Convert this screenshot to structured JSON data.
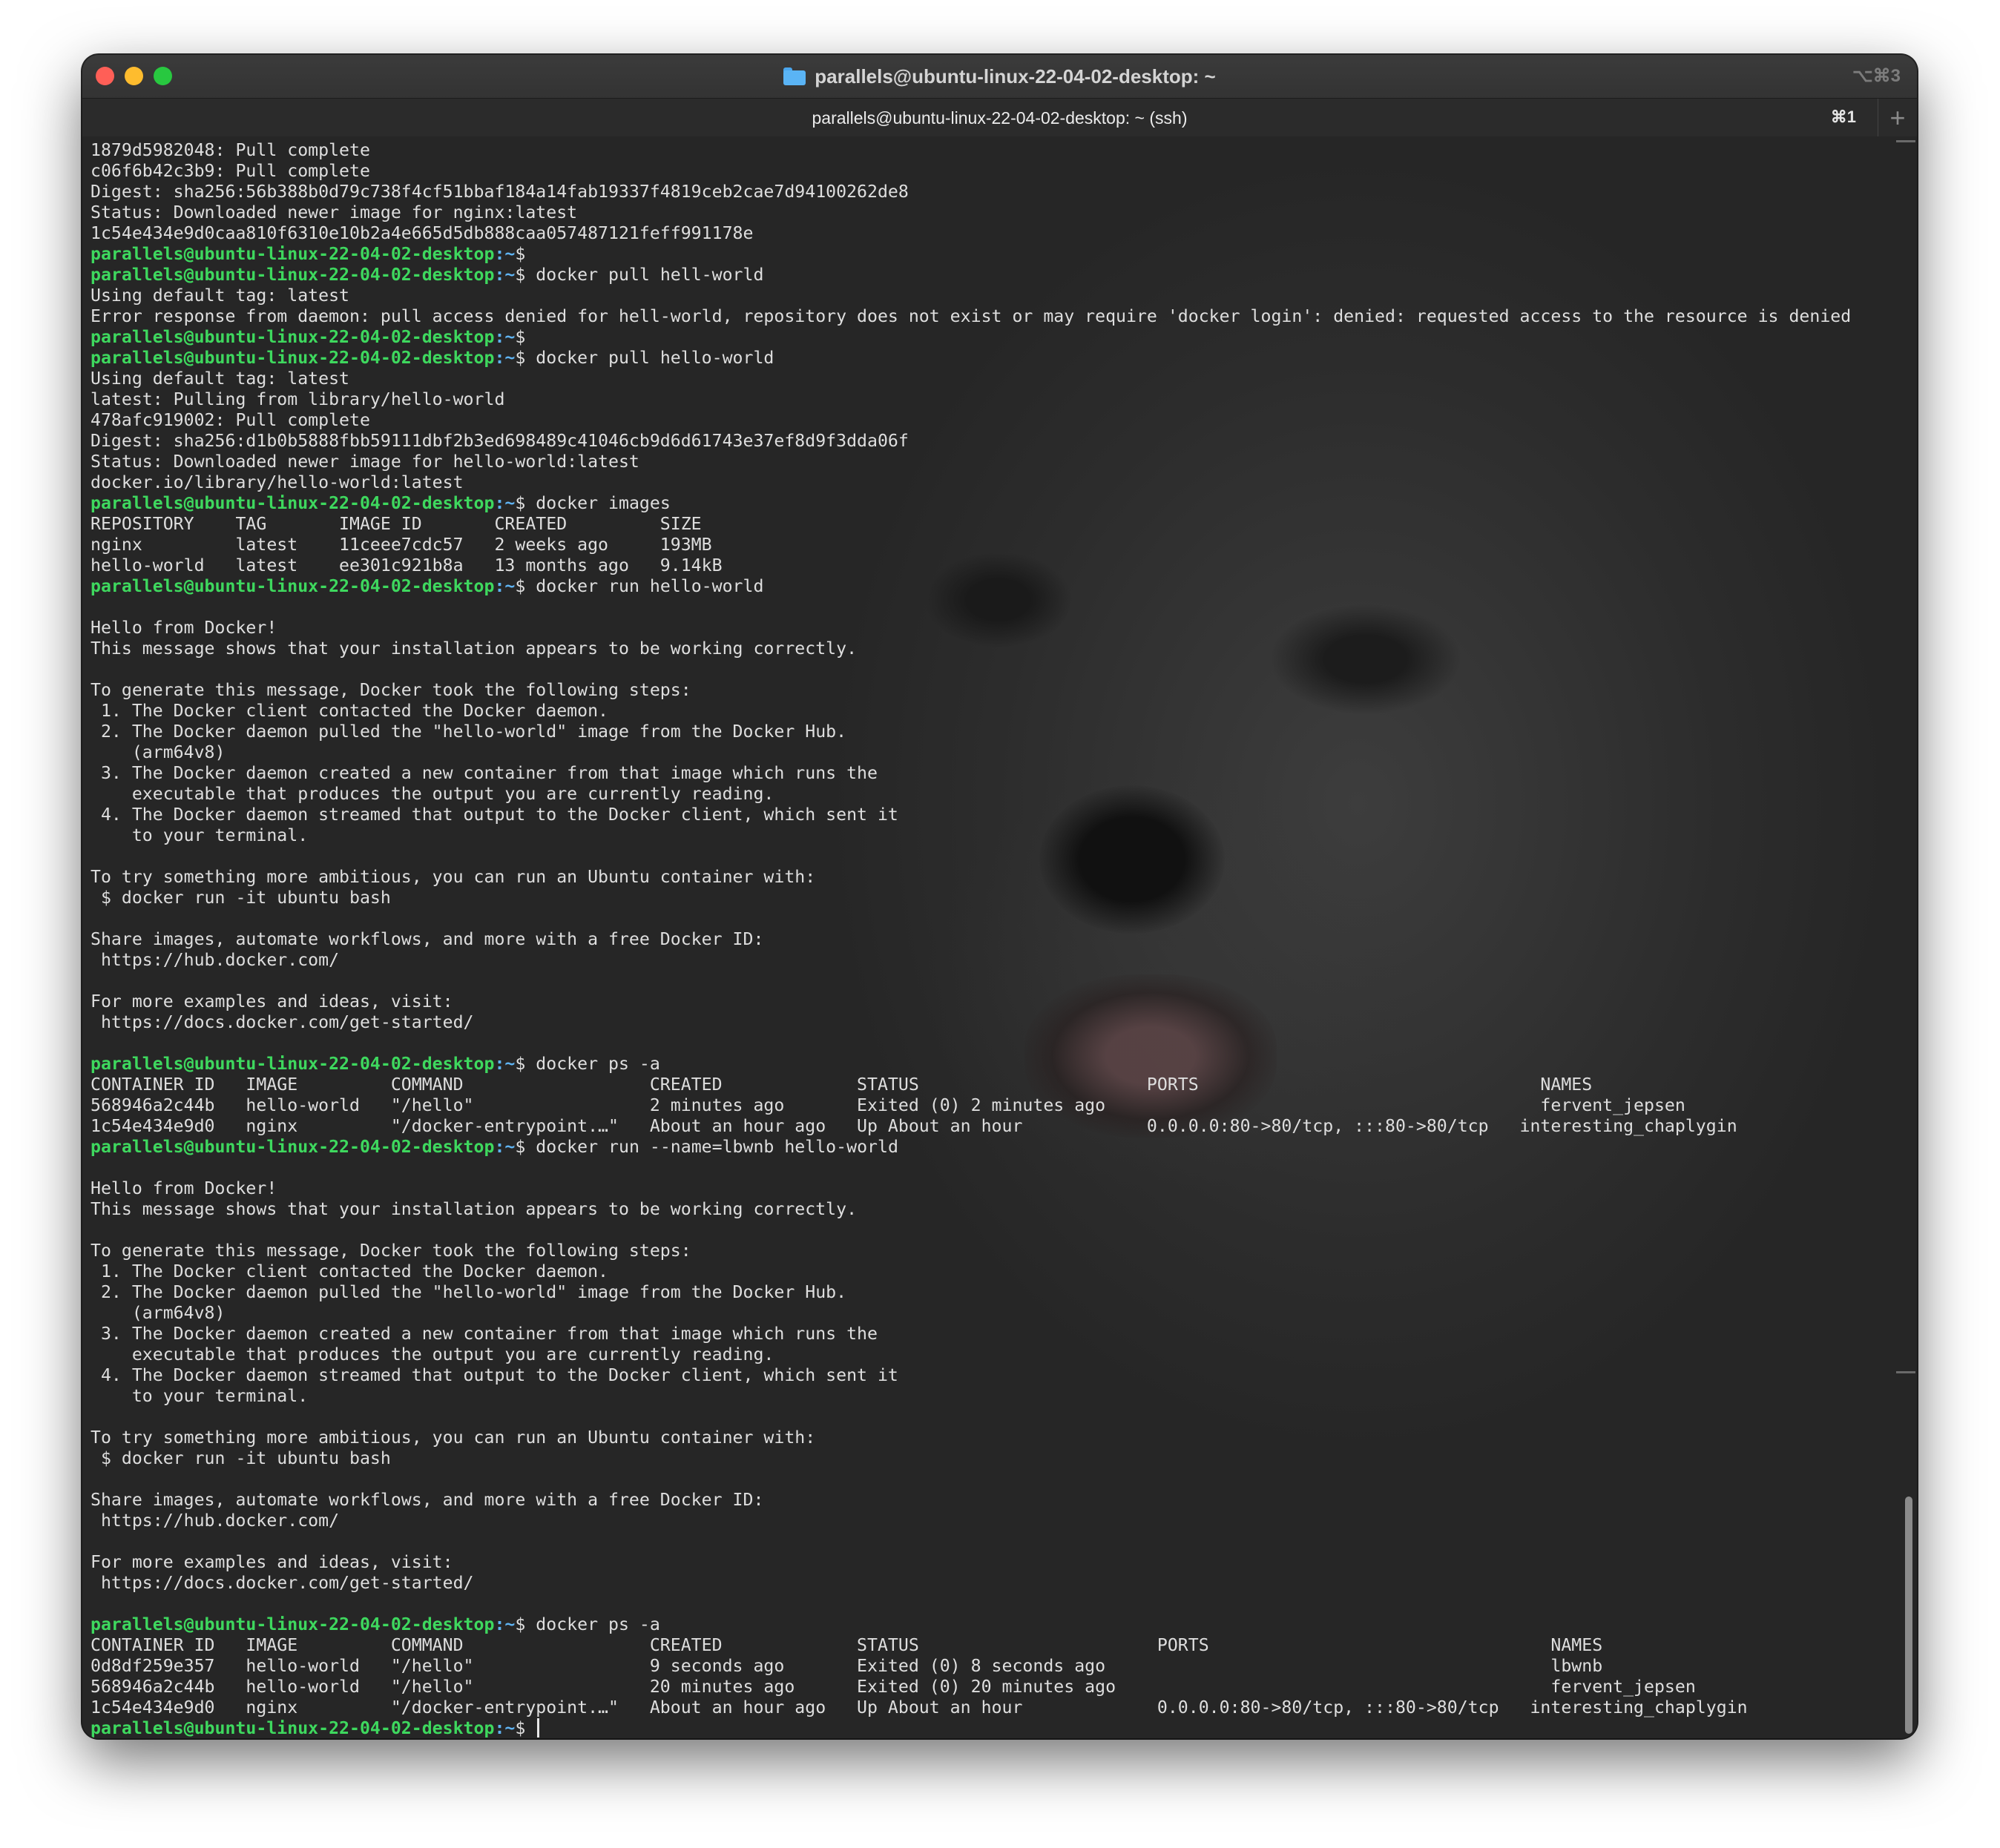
{
  "window": {
    "title": "parallels@ubuntu-linux-22-04-02-desktop: ~",
    "shortcut": "⌥⌘3",
    "tab_label": "parallels@ubuntu-linux-22-04-02-desktop: ~ (ssh)",
    "tab_shortcut": "⌘1",
    "new_tab": "+"
  },
  "prompt": {
    "user_host": "parallels@ubuntu-linux-22-04-02-desktop",
    "path": ":~",
    "symbol": "$"
  },
  "lines": [
    {
      "t": "1879d5982048: Pull complete"
    },
    {
      "t": "c06f6b42c3b9: Pull complete"
    },
    {
      "t": "Digest: sha256:56b388b0d79c738f4cf51bbaf184a14fab19337f4819ceb2cae7d94100262de8"
    },
    {
      "t": "Status: Downloaded newer image for nginx:latest"
    },
    {
      "t": "1c54e434e9d0caa810f6310e10b2a4e665d5db888caa057487121feff991178e"
    },
    {
      "p": true,
      "t": ""
    },
    {
      "p": true,
      "t": " docker pull hell-world"
    },
    {
      "t": "Using default tag: latest"
    },
    {
      "t": "Error response from daemon: pull access denied for hell-world, repository does not exist or may require 'docker login': denied: requested access to the resource is denied"
    },
    {
      "p": true,
      "t": ""
    },
    {
      "p": true,
      "t": " docker pull hello-world"
    },
    {
      "t": "Using default tag: latest"
    },
    {
      "t": "latest: Pulling from library/hello-world"
    },
    {
      "t": "478afc919002: Pull complete"
    },
    {
      "t": "Digest: sha256:d1b0b5888fbb59111dbf2b3ed698489c41046cb9d6d61743e37ef8d9f3dda06f"
    },
    {
      "t": "Status: Downloaded newer image for hello-world:latest"
    },
    {
      "t": "docker.io/library/hello-world:latest"
    },
    {
      "p": true,
      "t": " docker images"
    },
    {
      "t": "REPOSITORY    TAG       IMAGE ID       CREATED         SIZE"
    },
    {
      "t": "nginx         latest    11ceee7cdc57   2 weeks ago     193MB"
    },
    {
      "t": "hello-world   latest    ee301c921b8a   13 months ago   9.14kB"
    },
    {
      "p": true,
      "t": " docker run hello-world"
    },
    {
      "t": ""
    },
    {
      "t": "Hello from Docker!"
    },
    {
      "t": "This message shows that your installation appears to be working correctly."
    },
    {
      "t": ""
    },
    {
      "t": "To generate this message, Docker took the following steps:"
    },
    {
      "t": " 1. The Docker client contacted the Docker daemon."
    },
    {
      "t": " 2. The Docker daemon pulled the \"hello-world\" image from the Docker Hub."
    },
    {
      "t": "    (arm64v8)"
    },
    {
      "t": " 3. The Docker daemon created a new container from that image which runs the"
    },
    {
      "t": "    executable that produces the output you are currently reading."
    },
    {
      "t": " 4. The Docker daemon streamed that output to the Docker client, which sent it"
    },
    {
      "t": "    to your terminal."
    },
    {
      "t": ""
    },
    {
      "t": "To try something more ambitious, you can run an Ubuntu container with:"
    },
    {
      "t": " $ docker run -it ubuntu bash"
    },
    {
      "t": ""
    },
    {
      "t": "Share images, automate workflows, and more with a free Docker ID:"
    },
    {
      "t": " https://hub.docker.com/"
    },
    {
      "t": ""
    },
    {
      "t": "For more examples and ideas, visit:"
    },
    {
      "t": " https://docs.docker.com/get-started/"
    },
    {
      "t": ""
    },
    {
      "p": true,
      "t": " docker ps -a"
    },
    {
      "t": "CONTAINER ID   IMAGE         COMMAND                  CREATED             STATUS                      PORTS                                 NAMES"
    },
    {
      "t": "568946a2c44b   hello-world   \"/hello\"                 2 minutes ago       Exited (0) 2 minutes ago                                          fervent_jepsen"
    },
    {
      "t": "1c54e434e9d0   nginx         \"/docker-entrypoint.…\"   About an hour ago   Up About an hour            0.0.0.0:80->80/tcp, :::80->80/tcp   interesting_chaplygin"
    },
    {
      "p": true,
      "t": " docker run --name=lbwnb hello-world"
    },
    {
      "t": ""
    },
    {
      "t": "Hello from Docker!"
    },
    {
      "t": "This message shows that your installation appears to be working correctly."
    },
    {
      "t": ""
    },
    {
      "t": "To generate this message, Docker took the following steps:"
    },
    {
      "t": " 1. The Docker client contacted the Docker daemon."
    },
    {
      "t": " 2. The Docker daemon pulled the \"hello-world\" image from the Docker Hub."
    },
    {
      "t": "    (arm64v8)"
    },
    {
      "t": " 3. The Docker daemon created a new container from that image which runs the"
    },
    {
      "t": "    executable that produces the output you are currently reading."
    },
    {
      "t": " 4. The Docker daemon streamed that output to the Docker client, which sent it"
    },
    {
      "t": "    to your terminal."
    },
    {
      "t": ""
    },
    {
      "t": "To try something more ambitious, you can run an Ubuntu container with:"
    },
    {
      "t": " $ docker run -it ubuntu bash"
    },
    {
      "t": ""
    },
    {
      "t": "Share images, automate workflows, and more with a free Docker ID:"
    },
    {
      "t": " https://hub.docker.com/"
    },
    {
      "t": ""
    },
    {
      "t": "For more examples and ideas, visit:"
    },
    {
      "t": " https://docs.docker.com/get-started/"
    },
    {
      "t": ""
    },
    {
      "p": true,
      "t": " docker ps -a"
    },
    {
      "t": "CONTAINER ID   IMAGE         COMMAND                  CREATED             STATUS                       PORTS                                 NAMES"
    },
    {
      "t": "0d8df259e357   hello-world   \"/hello\"                 9 seconds ago       Exited (0) 8 seconds ago                                           lbwnb"
    },
    {
      "t": "568946a2c44b   hello-world   \"/hello\"                 20 minutes ago      Exited (0) 20 minutes ago                                          fervent_jepsen"
    },
    {
      "t": "1c54e434e9d0   nginx         \"/docker-entrypoint.…\"   About an hour ago   Up About an hour             0.0.0.0:80->80/tcp, :::80->80/tcp   interesting_chaplygin"
    },
    {
      "p": true,
      "t": " ",
      "cursor": true
    }
  ],
  "colors": {
    "prompt_user": "#3ed85e",
    "prompt_path": "#5fb3f2",
    "text": "#dedede",
    "background": "#252525"
  }
}
